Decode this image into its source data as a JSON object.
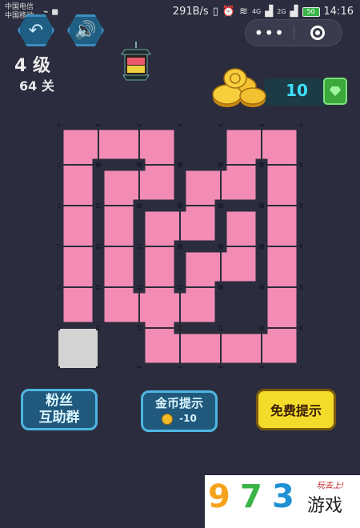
{
  "status_bar": {
    "carrier1": "中国电信",
    "carrier2": "中国移动",
    "speed": "291B/s",
    "net1": "4G",
    "net2": "2G",
    "battery": "50",
    "time": "14:16"
  },
  "toolbar": {
    "back_icon": "undo-arrow-icon",
    "sound_icon": "speaker-icon",
    "menu_dots": "•••"
  },
  "level": {
    "level_label": "4 级",
    "stage_label": "64 关"
  },
  "coins": {
    "amount": "10"
  },
  "buttons": {
    "fans_line1": "粉丝",
    "fans_line2": "互助群",
    "coin_hint_line1": "金币提示",
    "coin_hint_cost": "-10",
    "free_hint": "免费提示"
  },
  "watermark": {
    "d1": "9",
    "d2": "7",
    "d3": "3",
    "text": "游戏",
    "tag": "玩去上!"
  },
  "colors": {
    "background": "#2b2c3d",
    "path": "#f28cb5",
    "grid": "#2a2b3b",
    "empty_cell": "#d3d3d3",
    "coin_text": "#3ee0ff"
  }
}
